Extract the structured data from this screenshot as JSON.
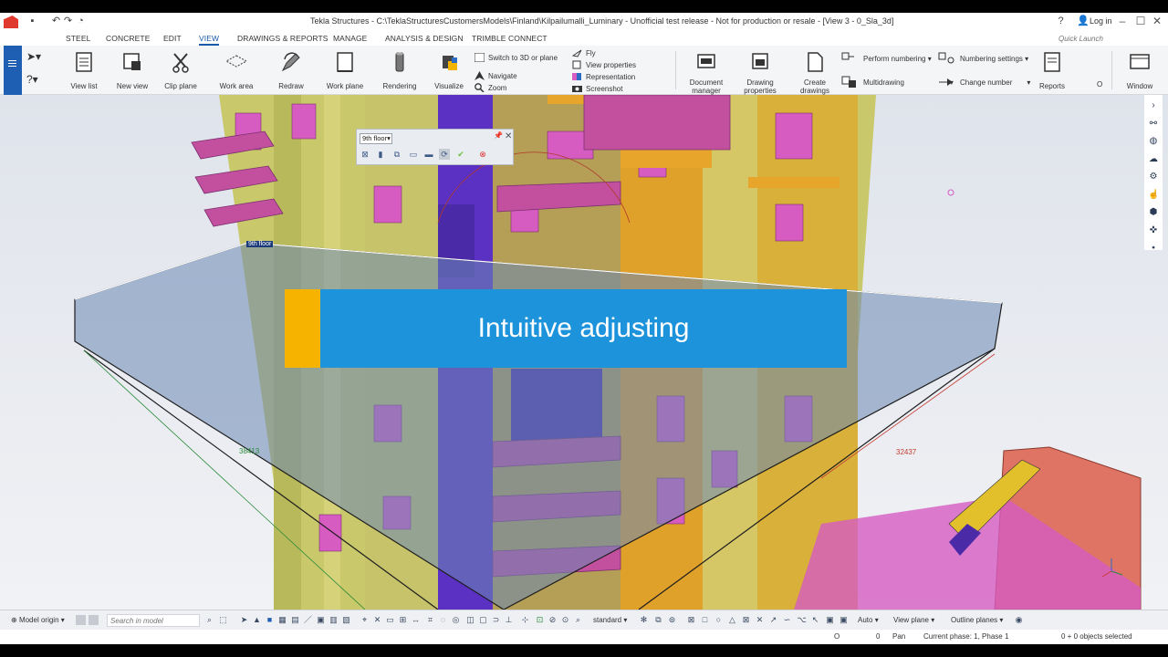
{
  "title_bar": {
    "title": "Tekla Structures - C:\\TeklaStructuresCustomersModels\\Finland\\Kilpailumalli_Luminary - Unofficial test release - Not for production or resale - [View 3 - 0_Sla_3d]",
    "login": "Log in",
    "icons": [
      "save-icon",
      "undo-icon",
      "redo-icon",
      "history-icon",
      "help-icon",
      "user-icon"
    ]
  },
  "ribbon_tabs": [
    {
      "label": "STEEL"
    },
    {
      "label": "CONCRETE"
    },
    {
      "label": "EDIT"
    },
    {
      "label": "VIEW",
      "active": true
    },
    {
      "label": "DRAWINGS & REPORTS"
    },
    {
      "label": "MANAGE"
    },
    {
      "label": "ANALYSIS & DESIGN"
    },
    {
      "label": "TRIMBLE CONNECT"
    }
  ],
  "quick_launch_placeholder": "Quick Launch",
  "ribbon": {
    "view_list": "View list",
    "new_view": "New view",
    "clip_plane": "Clip plane",
    "work_area": "Work area",
    "redraw": "Redraw",
    "work_plane": "Work plane",
    "rendering": "Rendering",
    "visualize": "Visualize",
    "switch_3d": "Switch to 3D or plane",
    "navigate": "Navigate",
    "zoom": "Zoom",
    "fly": "Fly",
    "view_properties": "View properties",
    "representation": "Representation",
    "screenshot": "Screenshot",
    "document_manager_1": "Document",
    "document_manager_2": "manager",
    "drawing_properties_1": "Drawing",
    "drawing_properties_2": "properties",
    "create_drawings_1": "Create",
    "create_drawings_2": "drawings",
    "perform_numbering": "Perform numbering",
    "numbering_settings": "Numbering settings",
    "multidrawing": "Multidrawing",
    "change_number": "Change number",
    "reports": "Reports",
    "window": "Window",
    "o_label": "O"
  },
  "viewport": {
    "floor_dropdown": "9th floor",
    "floor_label": "9th floor",
    "banner_text": "Intuitive adjusting",
    "dim_left": "38413",
    "dim_right": "32437",
    "colors": {
      "banner": "#1d93dc",
      "banner_accent": "#f6b400",
      "slab": "#6b88b5",
      "wall_yellow": "#d9c63a",
      "panel_pink": "#d65cc2",
      "panel_purple": "#5a2fc0"
    }
  },
  "bottom_toolbar": {
    "model_origin": "Model origin",
    "search_placeholder": "Search in model",
    "standard": "standard",
    "auto": "Auto",
    "view_plane": "View plane",
    "outline_planes": "Outline planes"
  },
  "status_bar": {
    "o": "O",
    "zero": "0",
    "pan": "Pan",
    "phase": "Current phase: 1, Phase 1",
    "selection": "0 + 0 objects selected"
  }
}
